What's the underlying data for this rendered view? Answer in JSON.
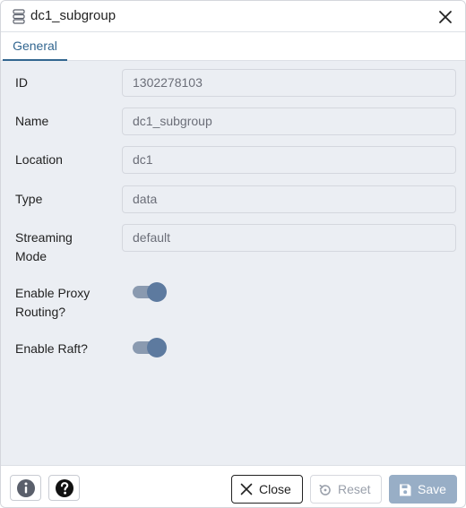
{
  "dialog": {
    "title": "dc1_subgroup",
    "title_icon": "server-group-icon",
    "close_icon": "close-icon"
  },
  "tabs": [
    {
      "label": "General",
      "active": true
    }
  ],
  "form": {
    "id_label": "ID",
    "id_value": "1302278103",
    "name_label": "Name",
    "name_value": "dc1_subgroup",
    "location_label": "Location",
    "location_value": "dc1",
    "type_label": "Type",
    "type_value": "data",
    "streaming_label_line1": "Streaming",
    "streaming_label_line2": "Mode",
    "streaming_value": "default",
    "proxy_label_line1": "Enable Proxy",
    "proxy_label_line2": "Routing?",
    "proxy_enabled": true,
    "raft_label": "Enable Raft?",
    "raft_enabled": true
  },
  "footer": {
    "info_icon": "info-icon",
    "help_icon": "help-icon",
    "close_label": "Close",
    "reset_label": "Reset",
    "save_label": "Save"
  },
  "colors": {
    "accent": "#326690",
    "toggle_on": "#5d7a9f",
    "save_disabled": "#98aec6",
    "panel_bg": "#ebeef3"
  }
}
